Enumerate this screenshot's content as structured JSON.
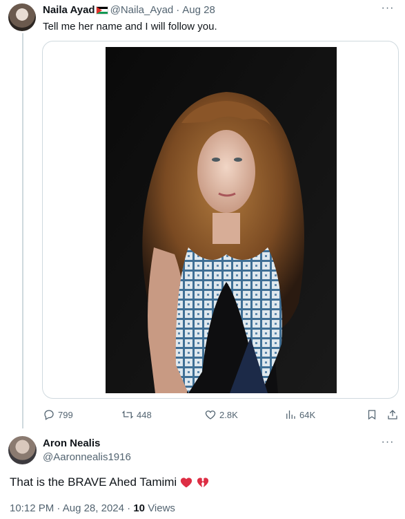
{
  "tweet": {
    "author_name": "Naila Ayad",
    "author_handle": "@Naila_Ayad",
    "separator": "·",
    "date": "Aug 28",
    "text": "Tell me her name and I will follow you.",
    "more_label": "···",
    "flag_icon": "palestine-flag-icon",
    "stats": {
      "replies": "799",
      "retweets": "448",
      "likes": "2.8K",
      "views": "64K"
    }
  },
  "reply": {
    "author_name": "Aron Nealis",
    "author_handle": "@Aaronnealis1916",
    "more_label": "···",
    "text": "That is the BRAVE Ahed Tamimi",
    "emoji_icons": [
      "red-heart-icon",
      "broken-heart-icon"
    ],
    "time": "10:12 PM",
    "separator": "·",
    "date": "Aug 28, 2024",
    "views_count": "10",
    "views_label": "Views"
  },
  "colors": {
    "text_primary": "#0f1419",
    "text_secondary": "#536471",
    "border": "#cfd9de",
    "heart_red": "#dd2e44"
  }
}
